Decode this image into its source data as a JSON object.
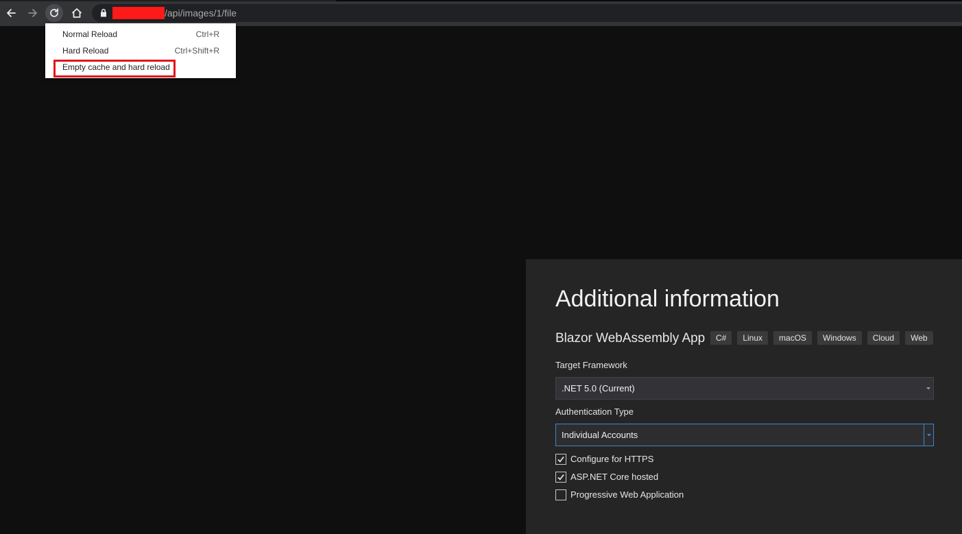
{
  "browser": {
    "url_path": "/api/images/1/file",
    "icons": {
      "back": "arrow-left-icon",
      "forward": "arrow-right-icon",
      "reload": "reload-icon",
      "home": "home-icon",
      "lock": "lock-icon"
    }
  },
  "reload_menu": {
    "items": [
      {
        "label": "Normal Reload",
        "shortcut": "Ctrl+R"
      },
      {
        "label": "Hard Reload",
        "shortcut": "Ctrl+Shift+R"
      },
      {
        "label": "Empty cache and hard reload",
        "shortcut": ""
      }
    ],
    "highlight_color": "#e3111b"
  },
  "dialog": {
    "title": "Additional information",
    "project_name": "Blazor WebAssembly App",
    "tags": [
      "C#",
      "Linux",
      "macOS",
      "Windows",
      "Cloud",
      "Web"
    ],
    "target_framework": {
      "label": "Target Framework",
      "value": ".NET 5.0 (Current)"
    },
    "authentication": {
      "label": "Authentication Type",
      "value": "Individual Accounts"
    },
    "options": [
      {
        "label": "Configure for HTTPS",
        "checked": true
      },
      {
        "label": "ASP.NET Core hosted",
        "checked": true
      },
      {
        "label": "Progressive Web Application",
        "checked": false
      }
    ]
  },
  "colors": {
    "page_bg": "#0f0f0f",
    "toolbar_bg": "#333436",
    "dialog_bg": "#252526",
    "focus_border": "#3e86c8",
    "redaction": "#ff1a1a"
  }
}
